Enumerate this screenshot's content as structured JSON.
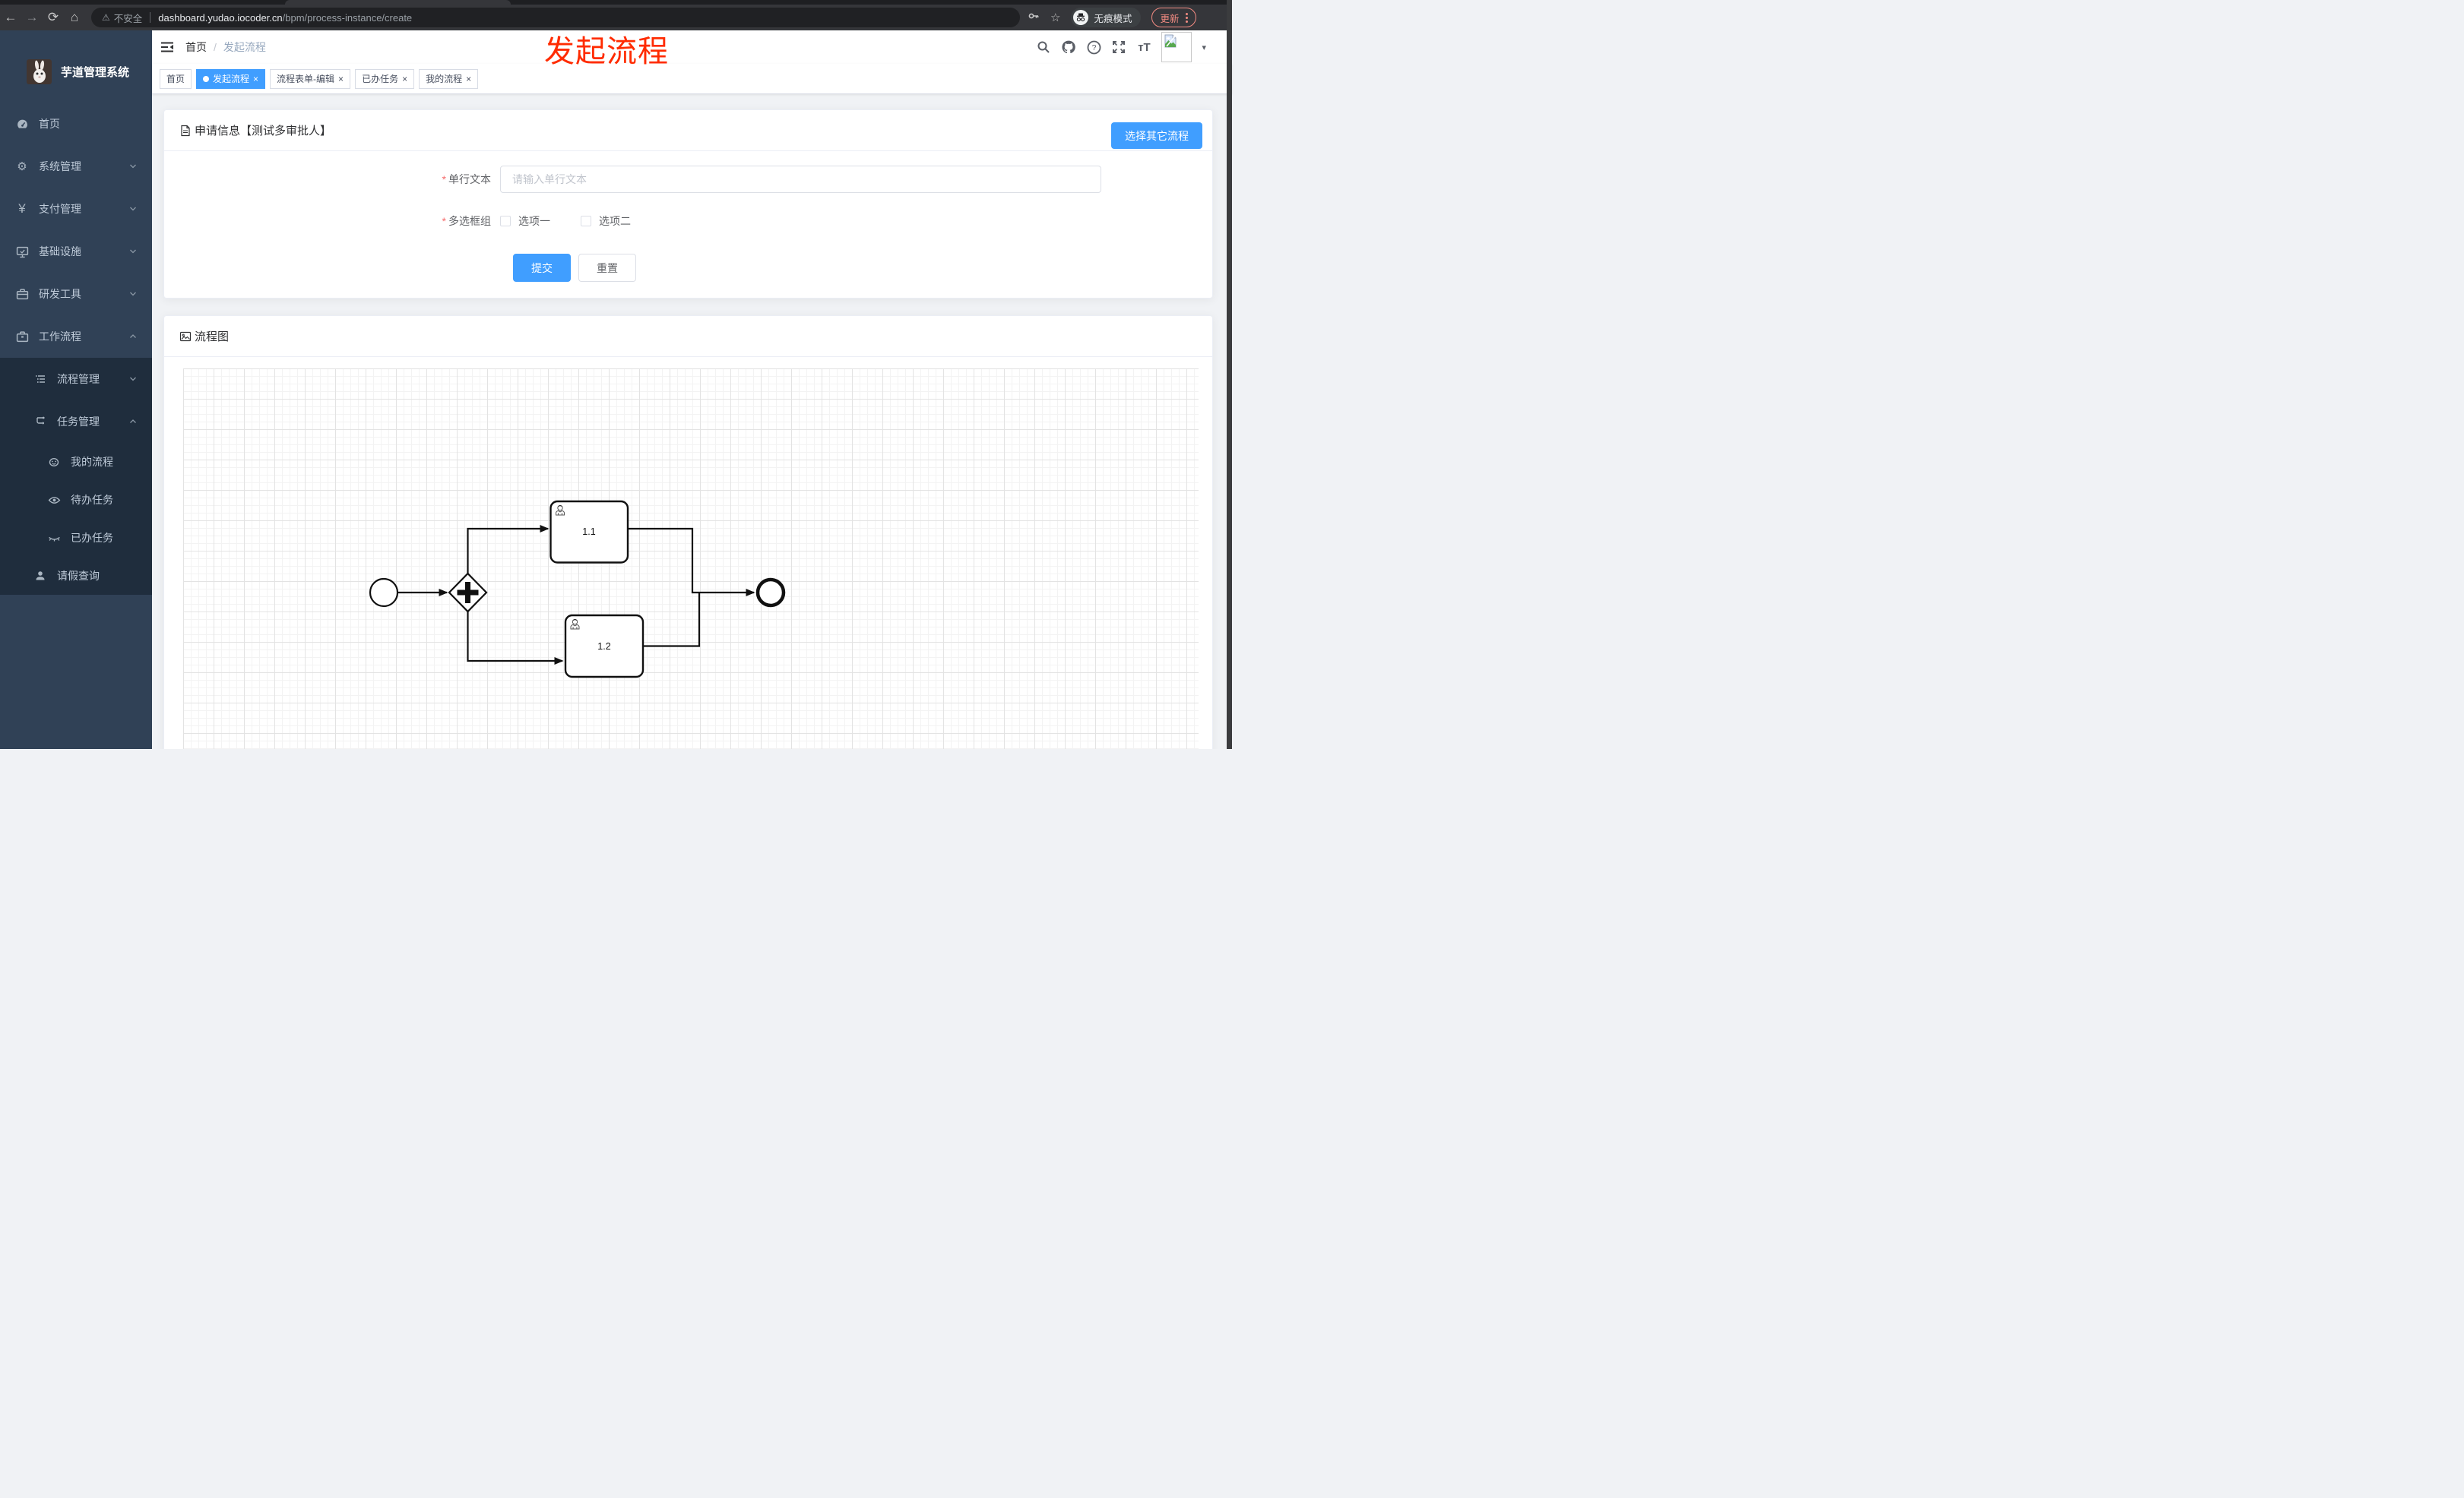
{
  "browser": {
    "back_icon": "left-arrow",
    "forward_icon": "right-arrow",
    "reload_icon": "reload",
    "home_icon": "home",
    "security_label": "不安全",
    "url_domain": "dashboard.yudao.iocoder.cn",
    "url_path": "/bpm/process-instance/create",
    "incognito_label": "无痕模式",
    "update_label": "更新",
    "accent_update_color": "#f28b82"
  },
  "sidebar": {
    "app_title": "芋道管理系统",
    "bg_color": "#304156",
    "submenu_bg_color": "#1f2d3d",
    "text_color": "#bfcbd9",
    "items": [
      {
        "label": "首页",
        "icon": "dashboard-icon",
        "level": 1
      },
      {
        "label": "系统管理",
        "icon": "gear-icon",
        "level": 1,
        "chevron": "down"
      },
      {
        "label": "支付管理",
        "icon": "yen-icon",
        "level": 1,
        "chevron": "down"
      },
      {
        "label": "基础设施",
        "icon": "monitor-icon",
        "level": 1,
        "chevron": "down"
      },
      {
        "label": "研发工具",
        "icon": "toolbox-icon",
        "level": 1,
        "chevron": "down"
      },
      {
        "label": "工作流程",
        "icon": "briefcase-icon",
        "level": 1,
        "chevron": "up"
      },
      {
        "label": "流程管理",
        "icon": "list-icon",
        "level": 2,
        "chevron": "down"
      },
      {
        "label": "任务管理",
        "icon": "flow-icon",
        "level": 2,
        "chevron": "up"
      },
      {
        "label": "我的流程",
        "icon": "face-icon",
        "level": 3
      },
      {
        "label": "待办任务",
        "icon": "eye-icon",
        "level": 3
      },
      {
        "label": "已办任务",
        "icon": "eye-off-icon",
        "level": 3
      },
      {
        "label": "请假查询",
        "icon": "user-icon",
        "level": 2
      }
    ]
  },
  "header": {
    "breadcrumb": {
      "first": "首页",
      "separator": "/",
      "current": "发起流程"
    },
    "right_icons": [
      "search-icon",
      "github-icon",
      "help-icon",
      "fullscreen-icon",
      "font-size-icon",
      "avatar-broken-image",
      "caret-down-icon"
    ],
    "caret_glyph": "▾"
  },
  "annotation": {
    "text": "发起流程",
    "color": "#ff2b00"
  },
  "tabs": [
    {
      "label": "首页",
      "active": false,
      "closable": false
    },
    {
      "label": "发起流程",
      "active": true,
      "closable": true
    },
    {
      "label": "流程表单-编辑",
      "active": false,
      "closable": true
    },
    {
      "label": "已办任务",
      "active": false,
      "closable": true
    },
    {
      "label": "我的流程",
      "active": false,
      "closable": true
    }
  ],
  "tab_close_glyph": "×",
  "form_card": {
    "title": "申请信息【测试多审批人】",
    "title_icon": "document-icon",
    "action_button": "选择其它流程",
    "fields": [
      {
        "label": "单行文本",
        "required": true,
        "type": "input",
        "placeholder": "请输入单行文本",
        "value": ""
      },
      {
        "label": "多选框组",
        "required": true,
        "type": "checkbox-group",
        "options": [
          {
            "label": "选项一",
            "checked": false
          },
          {
            "label": "选项二",
            "checked": false
          }
        ]
      }
    ],
    "submit_label": "提交",
    "reset_label": "重置",
    "required_mark": "*",
    "primary_color": "#409eff"
  },
  "diagram_card": {
    "title": "流程图",
    "title_icon": "image-icon",
    "diagram_type": "bpmn",
    "nodes": [
      {
        "id": "start",
        "type": "start-event"
      },
      {
        "id": "gateway",
        "type": "parallel-gateway",
        "symbol": "+"
      },
      {
        "id": "task1",
        "type": "user-task",
        "label": "1.1"
      },
      {
        "id": "task2",
        "type": "user-task",
        "label": "1.2"
      },
      {
        "id": "end",
        "type": "end-event"
      }
    ],
    "flows": [
      "start→gateway",
      "gateway→task1",
      "gateway→task2",
      "task1→end",
      "task2→end"
    ],
    "tasks": [
      {
        "label": "1.1"
      },
      {
        "label": "1.2"
      }
    ]
  }
}
